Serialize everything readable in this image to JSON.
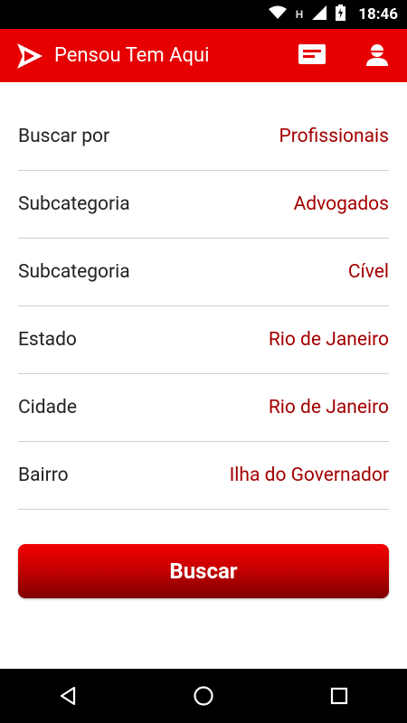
{
  "status_bar": {
    "time": "18:46",
    "icons": [
      "wifi-icon",
      "h-signal-icon",
      "cell-signal-icon",
      "battery-charging-icon"
    ]
  },
  "app_bar": {
    "title": "Pensou Tem Aqui",
    "logo": "play-logo-icon",
    "actions": [
      "message-icon",
      "person-icon"
    ]
  },
  "form": {
    "rows": [
      {
        "label": "Buscar por",
        "value": "Profissionais"
      },
      {
        "label": "Subcategoria",
        "value": "Advogados"
      },
      {
        "label": "Subcategoria",
        "value": "Cível"
      },
      {
        "label": "Estado",
        "value": "Rio de Janeiro"
      },
      {
        "label": "Cidade",
        "value": "Rio de Janeiro"
      },
      {
        "label": "Bairro",
        "value": "Ilha do Governador"
      }
    ],
    "submit_label": "Buscar"
  },
  "colors": {
    "brand": "#e60000",
    "value_text": "#a30000",
    "divider": "#cfcfcf"
  },
  "nav_bar": {
    "buttons": [
      "back-icon",
      "home-icon",
      "recents-icon"
    ]
  }
}
